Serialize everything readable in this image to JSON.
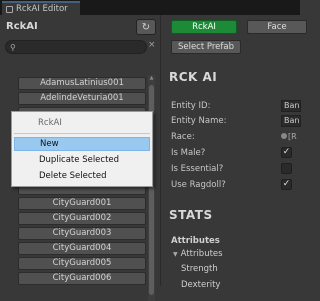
{
  "window": {
    "tab_title": "RckAI Editor"
  },
  "left_panel": {
    "title": "RckAI",
    "refresh_icon": "↻",
    "search": {
      "value": "",
      "placeholder": ""
    },
    "clear_icon": "×",
    "items": [
      "AdamusLatinius001",
      "AdelindeVeturia001",
      "",
      "",
      "",
      "",
      "",
      "",
      "CityGuard001",
      "CityGuard002",
      "CityGuard003",
      "CityGuard004",
      "CityGuard005",
      "CityGuard006"
    ]
  },
  "context_menu": {
    "header": "RckAI",
    "items": [
      "New",
      "Duplicate Selected",
      "Delete Selected"
    ],
    "highlighted": "New"
  },
  "right_panel": {
    "rckai_tab": "RckAI",
    "face_tab": "Face",
    "select_prefab": "Select Prefab",
    "heading": "RCK AI",
    "fields": {
      "entity_id_label": "Entity ID:",
      "entity_id_value": "Ban",
      "entity_name_label": "Entity Name:",
      "entity_name_value": "Ban",
      "race_label": "Race:",
      "race_value": "[R",
      "is_male_label": "Is Male?",
      "is_male": true,
      "is_essential_label": "Is Essential?",
      "is_essential": false,
      "use_ragdoll_label": "Use Ragdoll?",
      "use_ragdoll": true
    },
    "stats_heading": "STATS",
    "attributes_heading": "Attributes",
    "attributes_foldout": "Attributes",
    "stats": [
      "Strength",
      "Dexterity"
    ]
  },
  "colors": {
    "background": "#383838",
    "accent_green": "#1c8a36",
    "menu_highlight": "#99c9ef"
  }
}
